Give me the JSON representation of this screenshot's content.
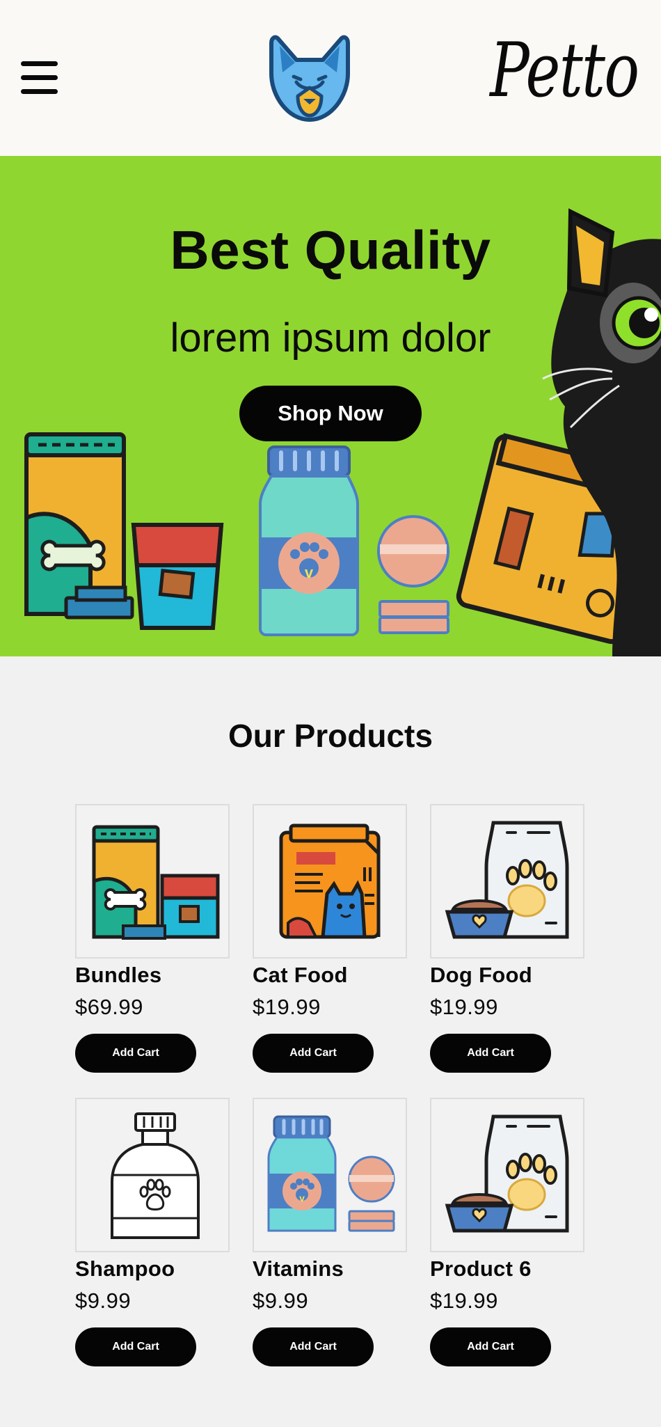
{
  "header": {
    "brand": "Petto",
    "menu_icon": "hamburger-menu-icon",
    "logo_icon": "dog-head-logo-icon"
  },
  "hero": {
    "title": "Best Quality",
    "subtitle": "lorem ipsum dolor",
    "cta_label": "Shop Now",
    "background_color": "#90d630"
  },
  "products": {
    "title": "Our Products",
    "items": [
      {
        "name": "Bundles",
        "price": "$69.99",
        "button": "Add Cart",
        "icon": "bundle-bags-icon"
      },
      {
        "name": "Cat Food",
        "price": "$19.99",
        "button": "Add Cart",
        "icon": "cat-food-bag-icon"
      },
      {
        "name": "Dog Food",
        "price": "$19.99",
        "button": "Add Cart",
        "icon": "dog-food-bag-icon"
      },
      {
        "name": "Shampoo",
        "price": "$9.99",
        "button": "Add Cart",
        "icon": "shampoo-bottle-icon"
      },
      {
        "name": "Vitamins",
        "price": "$9.99",
        "button": "Add Cart",
        "icon": "vitamins-bottle-icon"
      },
      {
        "name": "Product 6",
        "price": "$19.99",
        "button": "Add Cart",
        "icon": "dog-food-bag-icon"
      }
    ]
  }
}
